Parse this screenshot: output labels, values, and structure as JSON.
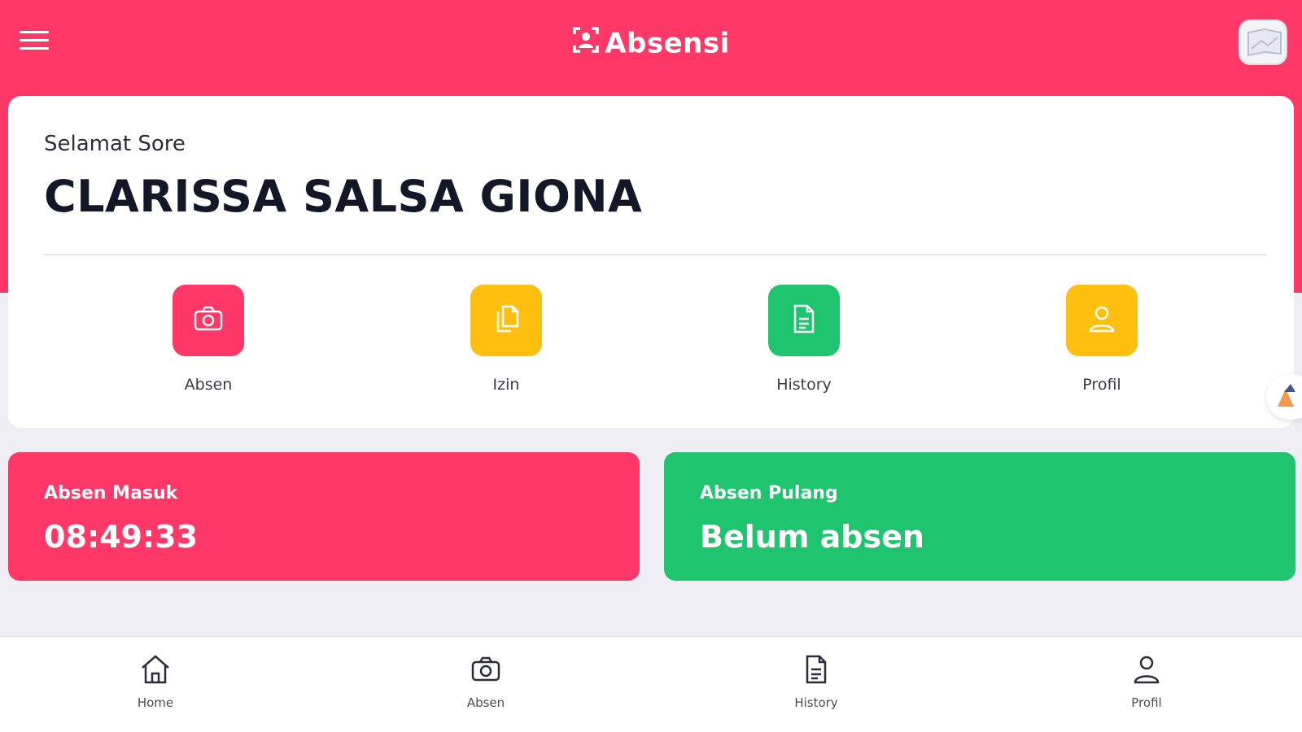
{
  "header": {
    "app_title": "Absensi",
    "menu_icon": "hamburger-icon",
    "logo_icon": "user-frame-icon",
    "avatar_icon": "profile-avatar"
  },
  "card": {
    "greeting": "Selamat Sore",
    "name": "CLARISSA SALSA GIONA"
  },
  "quick_actions": [
    {
      "label": "Absen",
      "icon": "camera-icon",
      "color": "#ff3868"
    },
    {
      "label": "Izin",
      "icon": "documents-icon",
      "color": "#ffbf0f"
    },
    {
      "label": "History",
      "icon": "document-icon",
      "color": "#1fc46e"
    },
    {
      "label": "Profil",
      "icon": "user-icon",
      "color": "#ffbf0f"
    }
  ],
  "status": {
    "check_in": {
      "label": "Absen Masuk",
      "value": "08:49:33",
      "color": "#ff3868"
    },
    "check_out": {
      "label": "Absen Pulang",
      "value": "Belum absen",
      "color": "#1fc46e"
    }
  },
  "bottom_nav": [
    {
      "label": "Home",
      "icon": "home-icon"
    },
    {
      "label": "Absen",
      "icon": "camera-icon"
    },
    {
      "label": "History",
      "icon": "document-icon"
    },
    {
      "label": "Profil",
      "icon": "user-icon"
    }
  ],
  "colors": {
    "primary": "#ff3868",
    "success": "#1fc46e",
    "warning": "#ffbf0f",
    "background": "#eeeef4"
  }
}
